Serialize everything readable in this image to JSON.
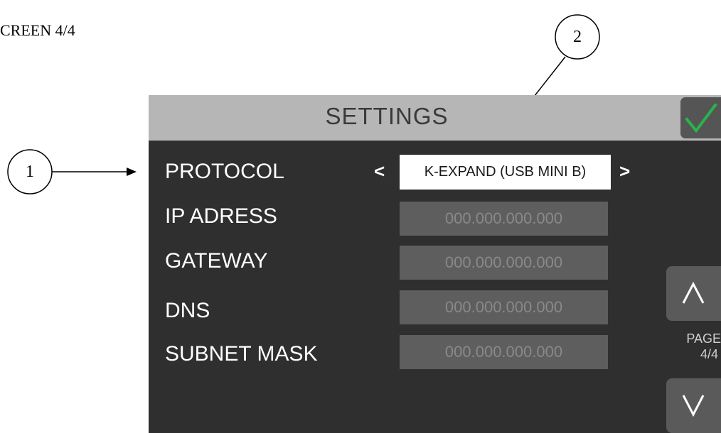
{
  "document": {
    "caption": "CREEN 4/4"
  },
  "callouts": [
    {
      "number": "1"
    },
    {
      "number": "2"
    }
  ],
  "screen": {
    "title": "SETTINGS",
    "confirm_icon": "check-icon",
    "protocol": {
      "label": "PROTOCOL",
      "prev": "<",
      "next": ">",
      "value": "K-EXPAND (USB MINI B)"
    },
    "fields": [
      {
        "label": "IP ADRESS",
        "value": "000.000.000.000"
      },
      {
        "label": "GATEWAY",
        "value": "000.000.000.000"
      },
      {
        "label": "DNS",
        "value": "000.000.000.000"
      },
      {
        "label": "SUBNET MASK",
        "value": "000.000.000.000"
      }
    ],
    "pager": {
      "label_line1": "PAGE",
      "label_line2": "4/4",
      "up_icon": "chevron-up-icon",
      "down_icon": "chevron-down-icon"
    },
    "colors": {
      "panel": "#2f2f2f",
      "header": "#b6b6b6",
      "check": "#2bb24c"
    }
  }
}
